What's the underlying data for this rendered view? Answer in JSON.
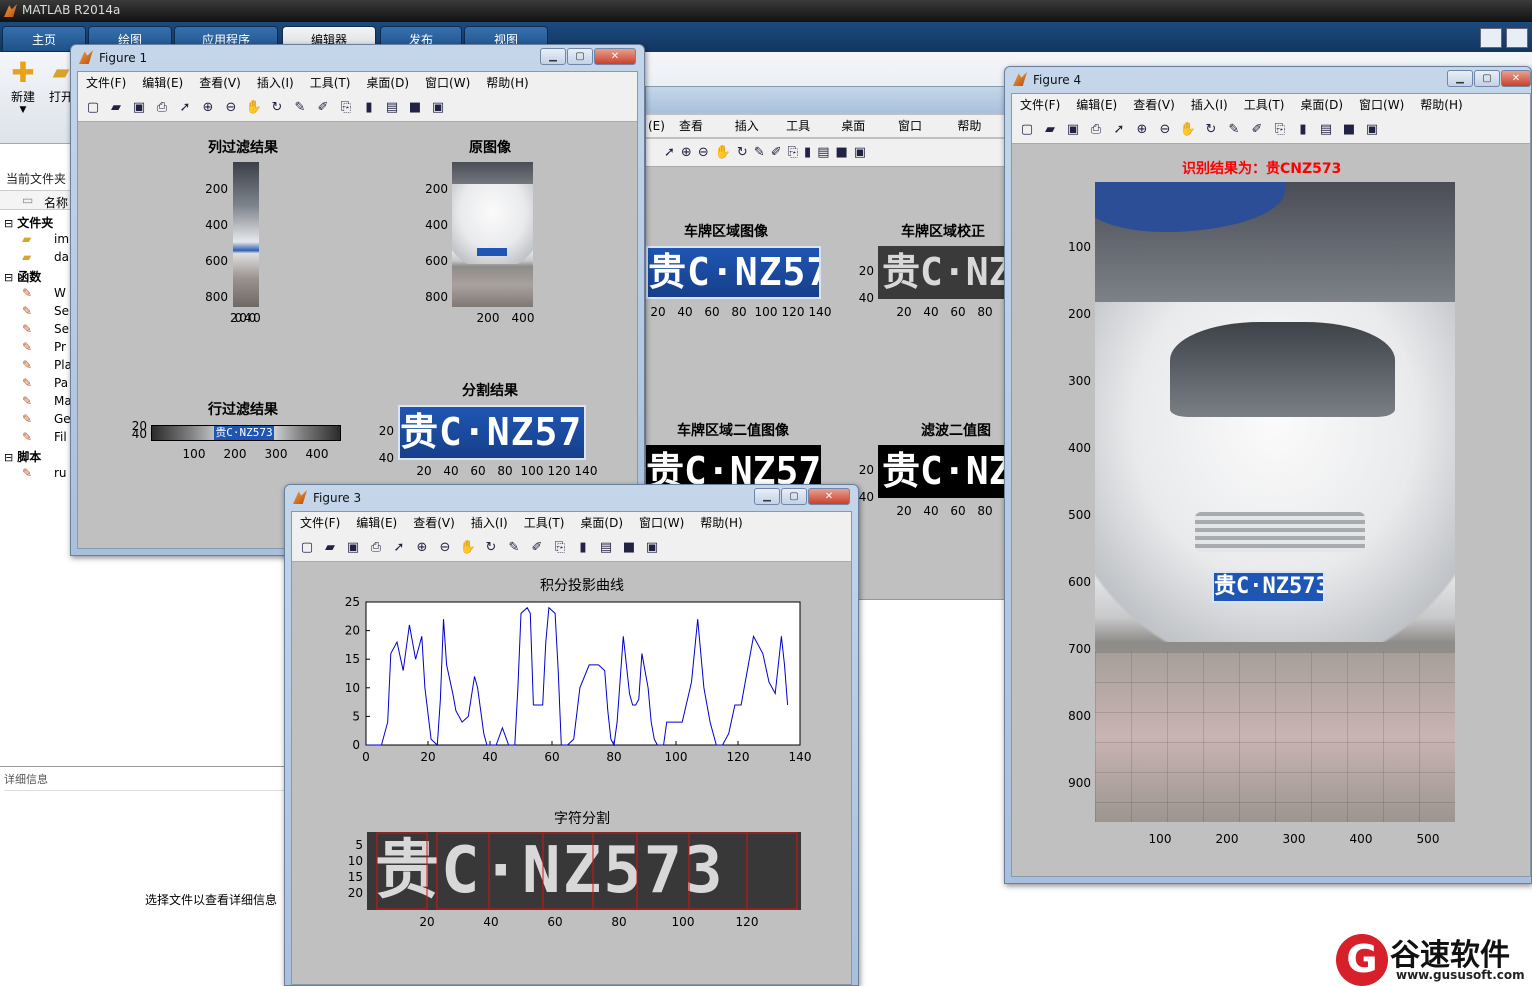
{
  "app": {
    "title": "MATLAB R2014a"
  },
  "ribbon": {
    "tabs": [
      "主页",
      "绘图",
      "应用程序",
      "编辑器",
      "发布",
      "视图"
    ],
    "selected": 3
  },
  "toolstrip": {
    "new_label": "新建",
    "open_label": "打开"
  },
  "leftpane": {
    "current_folder": "当前文件夹",
    "name_col": "名称",
    "groups": [
      {
        "label": "文件夹",
        "items": [
          "im",
          "da"
        ]
      },
      {
        "label": "函数",
        "items": [
          "W",
          "Se",
          "Se",
          "Pr",
          "Pla",
          "Pa",
          "Ma",
          "Ge",
          "Fil"
        ]
      },
      {
        "label": "脚本",
        "items": [
          "ru"
        ]
      }
    ]
  },
  "detail": {
    "header": "详细信息",
    "hint": "选择文件以查看详细信息"
  },
  "figure_menu": [
    "文件(F)",
    "编辑(E)",
    "查看(V)",
    "插入(I)",
    "工具(T)",
    "桌面(D)",
    "窗口(W)",
    "帮助(H)"
  ],
  "bg_figure_menu": [
    "(E)",
    "查看(V)",
    "插入(I)",
    "工具(T)",
    "桌面(D)",
    "窗口(W)",
    "帮助(H)"
  ],
  "figure1": {
    "title": "Figure 1",
    "col_filter": {
      "title": "列过滤结果",
      "yticks": [
        "200",
        "400",
        "600",
        "800"
      ],
      "xticks": "200400"
    },
    "original": {
      "title": "原图像",
      "yticks": [
        "200",
        "400",
        "600",
        "800"
      ],
      "xticks": [
        "200",
        "400"
      ]
    },
    "row_filter": {
      "title": "行过滤结果",
      "yticks": [
        "20",
        "40"
      ],
      "xticks": [
        "100",
        "200",
        "300",
        "400"
      ],
      "plate_text": "贵C·NZ573"
    },
    "segment": {
      "title": "分割结果",
      "yticks": [
        "20",
        "40"
      ],
      "xticks": [
        "20",
        "40",
        "60",
        "80",
        "100",
        "120",
        "140"
      ],
      "plate_text": "贵C·NZ573"
    }
  },
  "figure2": {
    "plate_region": {
      "title": "车牌区域图像",
      "text": "贵C·NZ573",
      "xticks": [
        "20",
        "40",
        "60",
        "80",
        "100",
        "120",
        "140"
      ]
    },
    "plate_corrected": {
      "title": "车牌区域校正",
      "text": "贵C·NZ5",
      "yticks": [
        "20",
        "40"
      ],
      "xticks": [
        "20",
        "40",
        "60",
        "80"
      ]
    },
    "plate_binary": {
      "title": "车牌区域二值图像",
      "text": "贵C·NZ573"
    },
    "filtered_binary": {
      "title": "滤波二值图",
      "text": "贵C·NZ5",
      "yticks": [
        "20",
        "40"
      ],
      "xticks": [
        "20",
        "40",
        "60",
        "80"
      ]
    }
  },
  "figure3": {
    "title": "Figure 3",
    "projection": {
      "title": "积分投影曲线"
    },
    "char_seg": {
      "title": "字符分割",
      "text": "贵C·NZ573",
      "yticks": [
        "5",
        "10",
        "15",
        "20"
      ],
      "xticks": [
        "20",
        "40",
        "60",
        "80",
        "100",
        "120"
      ]
    }
  },
  "figure4": {
    "title": "Figure 4",
    "result": "识别结果为：贵CNZ573",
    "plate_text": "贵C·NZ573",
    "yticks": [
      "100",
      "200",
      "300",
      "400",
      "500",
      "600",
      "700",
      "800",
      "900"
    ],
    "xticks": [
      "100",
      "200",
      "300",
      "400",
      "500"
    ]
  },
  "watermark": {
    "brand": "谷速软件",
    "url": "www.gususoft.com"
  },
  "chart_data": {
    "type": "line",
    "title": "积分投影曲线",
    "xlabel": "",
    "ylabel": "",
    "xlim": [
      0,
      140
    ],
    "ylim": [
      0,
      25
    ],
    "xticks": [
      0,
      20,
      40,
      60,
      80,
      100,
      120,
      140
    ],
    "yticks": [
      0,
      5,
      10,
      15,
      20,
      25
    ],
    "color": "#0000cc",
    "x": [
      0,
      5,
      7,
      8,
      10,
      12,
      14,
      16,
      18,
      19,
      21,
      23,
      24,
      25,
      26,
      28,
      29,
      30,
      31,
      33,
      35,
      36,
      37,
      38,
      39,
      40,
      41,
      42,
      44,
      46,
      48,
      49,
      50,
      52,
      53,
      54,
      55,
      57,
      58,
      59,
      61,
      62,
      63,
      64,
      65,
      67,
      69,
      72,
      75,
      77,
      78,
      79,
      80,
      81,
      83,
      85,
      86,
      87,
      88,
      89,
      91,
      92,
      93,
      94,
      95,
      96,
      97,
      99,
      100,
      102,
      105,
      107,
      109,
      111,
      113,
      115,
      117,
      119,
      121,
      123,
      125,
      128,
      130,
      132,
      134,
      135,
      136
    ],
    "y": [
      0,
      0,
      4,
      16,
      18,
      13,
      21,
      15,
      19,
      10,
      1,
      0,
      8,
      22,
      14,
      9,
      6,
      5,
      4,
      5,
      12,
      10,
      6,
      2,
      0,
      0,
      0,
      0,
      3,
      0,
      0,
      10,
      23,
      24,
      23,
      7,
      7,
      7,
      18,
      24,
      23,
      13,
      0,
      0,
      0,
      1,
      10,
      14,
      14,
      13,
      6,
      1,
      0,
      4,
      19,
      9,
      7,
      7,
      8,
      16,
      10,
      4,
      1,
      0,
      0,
      0,
      4,
      4,
      4,
      4,
      11,
      22,
      10,
      4,
      0,
      0,
      2,
      7,
      7,
      13,
      19,
      16,
      11,
      9,
      19,
      14,
      7
    ]
  }
}
